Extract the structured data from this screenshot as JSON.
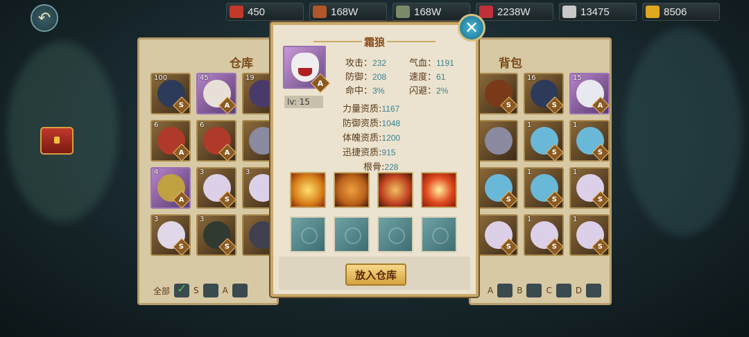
{
  "header": {
    "currencies": [
      {
        "icon": "scroll-icon",
        "value": "450",
        "color": "#c0392b"
      },
      {
        "icon": "wood-icon",
        "value": "168W",
        "color": "#b0562a"
      },
      {
        "icon": "stone-icon",
        "value": "168W",
        "color": "#7a8a6a"
      },
      {
        "icon": "ruby-icon",
        "value": "2238W",
        "color": "#c0303a"
      },
      {
        "icon": "silver-ingot-icon",
        "value": "13475",
        "color": "#c8c8c8"
      },
      {
        "icon": "gold-ingot-icon",
        "value": "8506",
        "color": "#e0a820"
      }
    ]
  },
  "warehouse": {
    "title": "仓库",
    "cells": [
      {
        "count": "100",
        "grade": "S",
        "tone": "brown"
      },
      {
        "count": "45",
        "grade": "A",
        "tone": "purple"
      },
      {
        "count": "19",
        "grade": "",
        "tone": "brown"
      },
      {
        "count": "6",
        "grade": "A",
        "tone": "brown"
      },
      {
        "count": "6",
        "grade": "A",
        "tone": "brown"
      },
      {
        "count": "",
        "grade": "",
        "tone": "brown"
      },
      {
        "count": "4",
        "grade": "A",
        "tone": "purple"
      },
      {
        "count": "3",
        "grade": "S",
        "tone": "brown"
      },
      {
        "count": "3",
        "grade": "",
        "tone": "brown"
      },
      {
        "count": "3",
        "grade": "S",
        "tone": "brown"
      },
      {
        "count": "3",
        "grade": "S",
        "tone": "brown"
      },
      {
        "count": "",
        "grade": "",
        "tone": "brown"
      }
    ],
    "filters": {
      "all": "全部",
      "s": "S",
      "a": "A"
    }
  },
  "backpack": {
    "title": "背包",
    "cells": [
      {
        "count": "",
        "grade": "S",
        "tone": "brown"
      },
      {
        "count": "16",
        "grade": "S",
        "tone": "brown"
      },
      {
        "count": "15",
        "grade": "A",
        "tone": "purple"
      },
      {
        "count": "",
        "grade": "",
        "tone": "brown"
      },
      {
        "count": "1",
        "grade": "S",
        "tone": "brown"
      },
      {
        "count": "1",
        "grade": "S",
        "tone": "brown"
      },
      {
        "count": "",
        "grade": "S",
        "tone": "brown"
      },
      {
        "count": "1",
        "grade": "S",
        "tone": "brown"
      },
      {
        "count": "1",
        "grade": "S",
        "tone": "brown"
      },
      {
        "count": "",
        "grade": "S",
        "tone": "brown"
      },
      {
        "count": "1",
        "grade": "S",
        "tone": "brown"
      },
      {
        "count": "1",
        "grade": "S",
        "tone": "brown"
      }
    ],
    "filters": {
      "a": "A",
      "b": "B",
      "c": "C",
      "d": "D"
    }
  },
  "detail": {
    "name": "霜狼",
    "grade": "A",
    "level_label": "lv: 15",
    "stats": {
      "attack": {
        "label": "攻击：",
        "value": "232"
      },
      "hp": {
        "label": "气血：",
        "value": "1191"
      },
      "defense": {
        "label": "防御：",
        "value": "208"
      },
      "speed": {
        "label": "速度：",
        "value": "61"
      },
      "hit": {
        "label": "命中：",
        "value": "3%"
      },
      "dodge": {
        "label": "闪避：",
        "value": "2%"
      }
    },
    "aptitudes": [
      {
        "label": "力量资质:",
        "value": "1167"
      },
      {
        "label": "防御资质:",
        "value": "1048"
      },
      {
        "label": "体魄资质:",
        "value": "1200"
      },
      {
        "label": "迅捷资质:",
        "value": "915"
      },
      {
        "label": "根骨:",
        "value": "228"
      }
    ],
    "skills": [
      {
        "icon": "golden-burst-skill-icon"
      },
      {
        "icon": "roaring-tiger-skill-icon"
      },
      {
        "icon": "fire-shield-skill-icon"
      },
      {
        "icon": "flame-strike-skill-icon"
      }
    ],
    "empty_slots": 4,
    "action_button": "放入仓库"
  }
}
